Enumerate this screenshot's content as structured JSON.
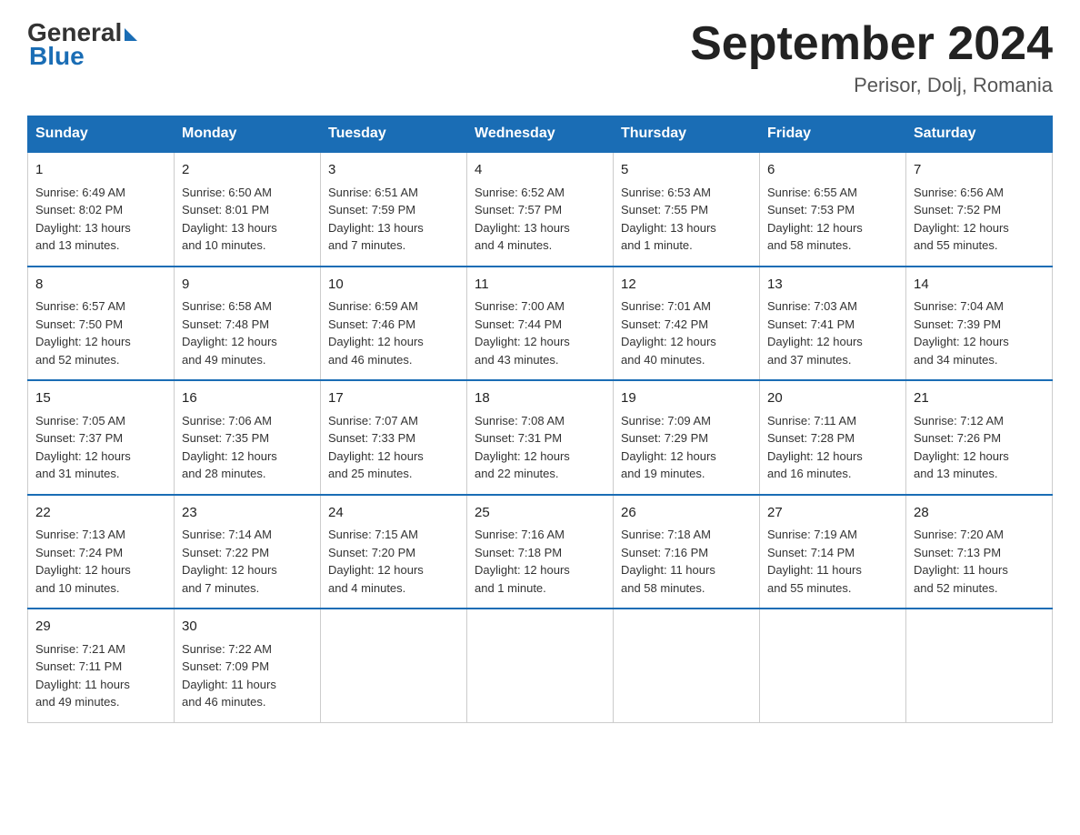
{
  "logo": {
    "text_general": "General",
    "text_blue": "Blue"
  },
  "title": "September 2024",
  "subtitle": "Perisor, Dolj, Romania",
  "days_of_week": [
    "Sunday",
    "Monday",
    "Tuesday",
    "Wednesday",
    "Thursday",
    "Friday",
    "Saturday"
  ],
  "weeks": [
    [
      {
        "day": "1",
        "sunrise": "6:49 AM",
        "sunset": "8:02 PM",
        "daylight": "13 hours and 13 minutes."
      },
      {
        "day": "2",
        "sunrise": "6:50 AM",
        "sunset": "8:01 PM",
        "daylight": "13 hours and 10 minutes."
      },
      {
        "day": "3",
        "sunrise": "6:51 AM",
        "sunset": "7:59 PM",
        "daylight": "13 hours and 7 minutes."
      },
      {
        "day": "4",
        "sunrise": "6:52 AM",
        "sunset": "7:57 PM",
        "daylight": "13 hours and 4 minutes."
      },
      {
        "day": "5",
        "sunrise": "6:53 AM",
        "sunset": "7:55 PM",
        "daylight": "13 hours and 1 minute."
      },
      {
        "day": "6",
        "sunrise": "6:55 AM",
        "sunset": "7:53 PM",
        "daylight": "12 hours and 58 minutes."
      },
      {
        "day": "7",
        "sunrise": "6:56 AM",
        "sunset": "7:52 PM",
        "daylight": "12 hours and 55 minutes."
      }
    ],
    [
      {
        "day": "8",
        "sunrise": "6:57 AM",
        "sunset": "7:50 PM",
        "daylight": "12 hours and 52 minutes."
      },
      {
        "day": "9",
        "sunrise": "6:58 AM",
        "sunset": "7:48 PM",
        "daylight": "12 hours and 49 minutes."
      },
      {
        "day": "10",
        "sunrise": "6:59 AM",
        "sunset": "7:46 PM",
        "daylight": "12 hours and 46 minutes."
      },
      {
        "day": "11",
        "sunrise": "7:00 AM",
        "sunset": "7:44 PM",
        "daylight": "12 hours and 43 minutes."
      },
      {
        "day": "12",
        "sunrise": "7:01 AM",
        "sunset": "7:42 PM",
        "daylight": "12 hours and 40 minutes."
      },
      {
        "day": "13",
        "sunrise": "7:03 AM",
        "sunset": "7:41 PM",
        "daylight": "12 hours and 37 minutes."
      },
      {
        "day": "14",
        "sunrise": "7:04 AM",
        "sunset": "7:39 PM",
        "daylight": "12 hours and 34 minutes."
      }
    ],
    [
      {
        "day": "15",
        "sunrise": "7:05 AM",
        "sunset": "7:37 PM",
        "daylight": "12 hours and 31 minutes."
      },
      {
        "day": "16",
        "sunrise": "7:06 AM",
        "sunset": "7:35 PM",
        "daylight": "12 hours and 28 minutes."
      },
      {
        "day": "17",
        "sunrise": "7:07 AM",
        "sunset": "7:33 PM",
        "daylight": "12 hours and 25 minutes."
      },
      {
        "day": "18",
        "sunrise": "7:08 AM",
        "sunset": "7:31 PM",
        "daylight": "12 hours and 22 minutes."
      },
      {
        "day": "19",
        "sunrise": "7:09 AM",
        "sunset": "7:29 PM",
        "daylight": "12 hours and 19 minutes."
      },
      {
        "day": "20",
        "sunrise": "7:11 AM",
        "sunset": "7:28 PM",
        "daylight": "12 hours and 16 minutes."
      },
      {
        "day": "21",
        "sunrise": "7:12 AM",
        "sunset": "7:26 PM",
        "daylight": "12 hours and 13 minutes."
      }
    ],
    [
      {
        "day": "22",
        "sunrise": "7:13 AM",
        "sunset": "7:24 PM",
        "daylight": "12 hours and 10 minutes."
      },
      {
        "day": "23",
        "sunrise": "7:14 AM",
        "sunset": "7:22 PM",
        "daylight": "12 hours and 7 minutes."
      },
      {
        "day": "24",
        "sunrise": "7:15 AM",
        "sunset": "7:20 PM",
        "daylight": "12 hours and 4 minutes."
      },
      {
        "day": "25",
        "sunrise": "7:16 AM",
        "sunset": "7:18 PM",
        "daylight": "12 hours and 1 minute."
      },
      {
        "day": "26",
        "sunrise": "7:18 AM",
        "sunset": "7:16 PM",
        "daylight": "11 hours and 58 minutes."
      },
      {
        "day": "27",
        "sunrise": "7:19 AM",
        "sunset": "7:14 PM",
        "daylight": "11 hours and 55 minutes."
      },
      {
        "day": "28",
        "sunrise": "7:20 AM",
        "sunset": "7:13 PM",
        "daylight": "11 hours and 52 minutes."
      }
    ],
    [
      {
        "day": "29",
        "sunrise": "7:21 AM",
        "sunset": "7:11 PM",
        "daylight": "11 hours and 49 minutes."
      },
      {
        "day": "30",
        "sunrise": "7:22 AM",
        "sunset": "7:09 PM",
        "daylight": "11 hours and 46 minutes."
      },
      null,
      null,
      null,
      null,
      null
    ]
  ],
  "labels": {
    "sunrise": "Sunrise:",
    "sunset": "Sunset:",
    "daylight": "Daylight:"
  }
}
